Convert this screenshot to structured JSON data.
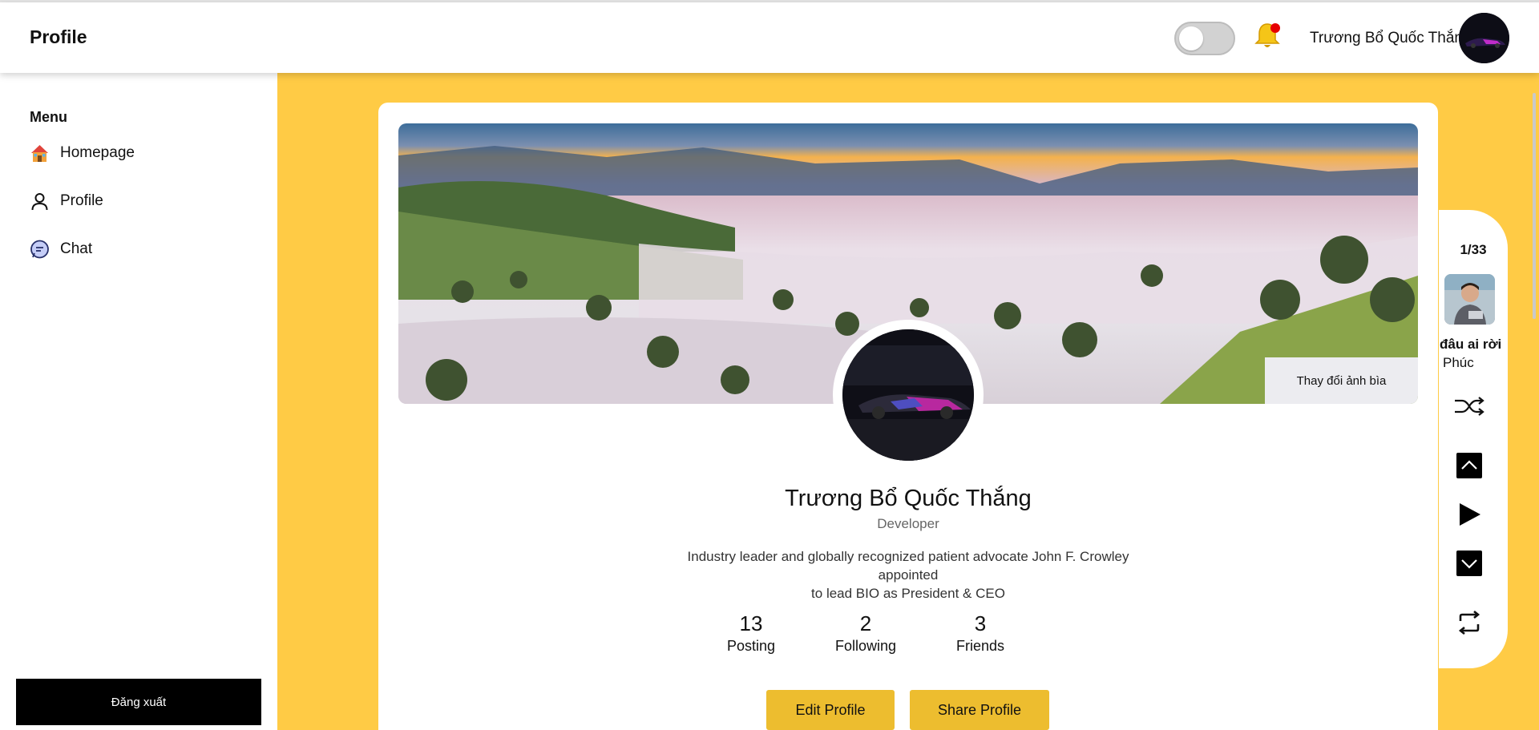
{
  "header": {
    "title": "Profile",
    "user_name": "Trương Bổ Quốc Thắng",
    "theme_toggle": "off",
    "notification_icon": "bell-icon"
  },
  "sidebar": {
    "heading": "Menu",
    "items": [
      {
        "label": "Homepage",
        "icon": "home-icon"
      },
      {
        "label": "Profile",
        "icon": "user-icon"
      },
      {
        "label": "Chat",
        "icon": "chat-icon"
      }
    ],
    "logout_label": "Đăng xuất"
  },
  "profile": {
    "cover_button": "Thay đổi ảnh bìa",
    "name": "Trương Bổ Quốc Thắng",
    "role": "Developer",
    "bio_line1": "Industry leader and globally recognized patient advocate John F. Crowley appointed",
    "bio_line2": "to lead BIO as President & CEO",
    "stats": [
      {
        "value": "13",
        "label": "Posting"
      },
      {
        "value": "2",
        "label": "Following"
      },
      {
        "value": "3",
        "label": "Friends"
      }
    ],
    "edit_button": "Edit Profile",
    "share_button": "Share Profile"
  },
  "music": {
    "track_counter": "1/33",
    "song_title": "đâu ai rời",
    "artist": "Phúc",
    "controls": [
      "shuffle-icon",
      "chevron-up-icon",
      "play-icon",
      "chevron-down-icon",
      "repeat-icon"
    ]
  },
  "colors": {
    "accent_background": "#ffcb45",
    "button_yellow": "#edbd2f",
    "logout_black": "#000000",
    "notification_dot": "#e60000"
  }
}
